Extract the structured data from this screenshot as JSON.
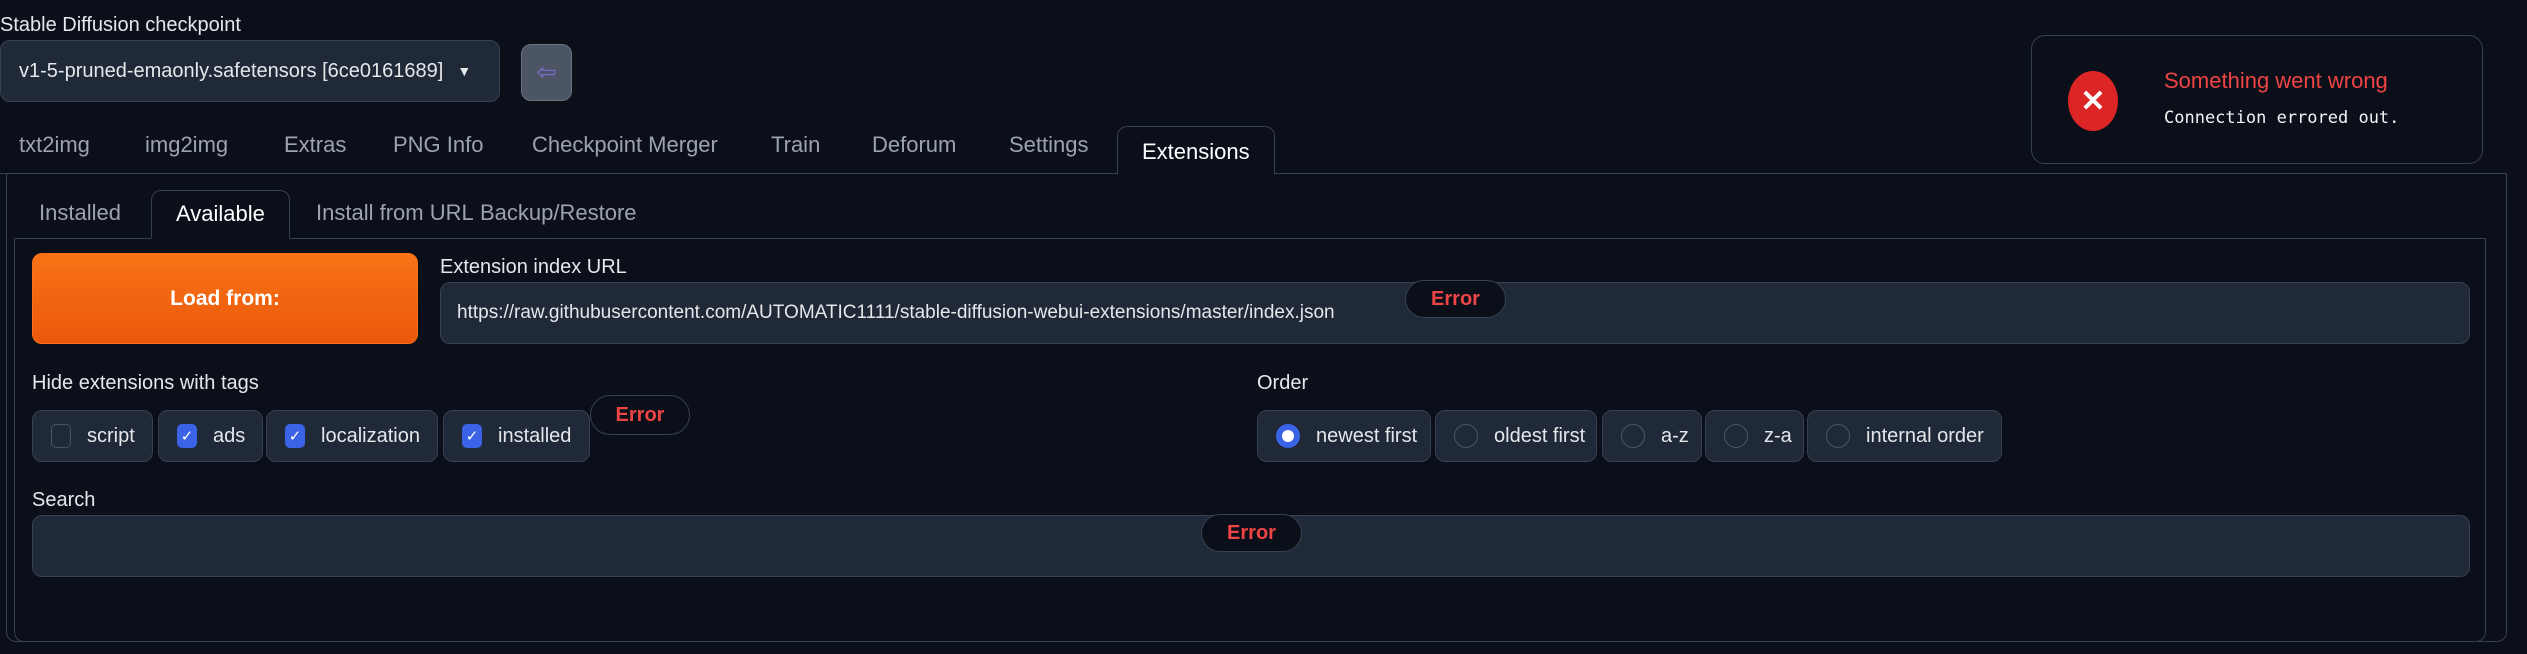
{
  "checkpoint": {
    "label": "Stable Diffusion checkpoint",
    "value": "v1-5-pruned-emaonly.safetensors [6ce0161689]",
    "swap_icon": "END"
  },
  "toast": {
    "title": "Something went wrong",
    "message": "Connection errored out."
  },
  "tabs": [
    "txt2img",
    "img2img",
    "Extras",
    "PNG Info",
    "Checkpoint Merger",
    "Train",
    "Deforum",
    "Settings",
    "Extensions"
  ],
  "subtabs": [
    "Installed",
    "Available",
    "Install from URL",
    "Backup/Restore"
  ],
  "available": {
    "load_button": "Load from:",
    "index_url_label": "Extension index URL",
    "index_url_value": "https://raw.githubusercontent.com/AUTOMATIC1111/stable-diffusion-webui-extensions/master/index.json",
    "error": "Error",
    "hide_label": "Hide extensions with tags",
    "tags": [
      {
        "label": "script",
        "checked": false
      },
      {
        "label": "ads",
        "checked": true
      },
      {
        "label": "localization",
        "checked": true
      },
      {
        "label": "installed",
        "checked": true
      }
    ],
    "order_label": "Order",
    "order_options": [
      "newest first",
      "oldest first",
      "a-z",
      "z-a",
      "internal order"
    ],
    "order_selected": "newest first",
    "search_label": "Search",
    "search_value": ""
  },
  "colors": {
    "accent": "#3b63e6",
    "error": "#ef4444",
    "button": "#f97316"
  }
}
